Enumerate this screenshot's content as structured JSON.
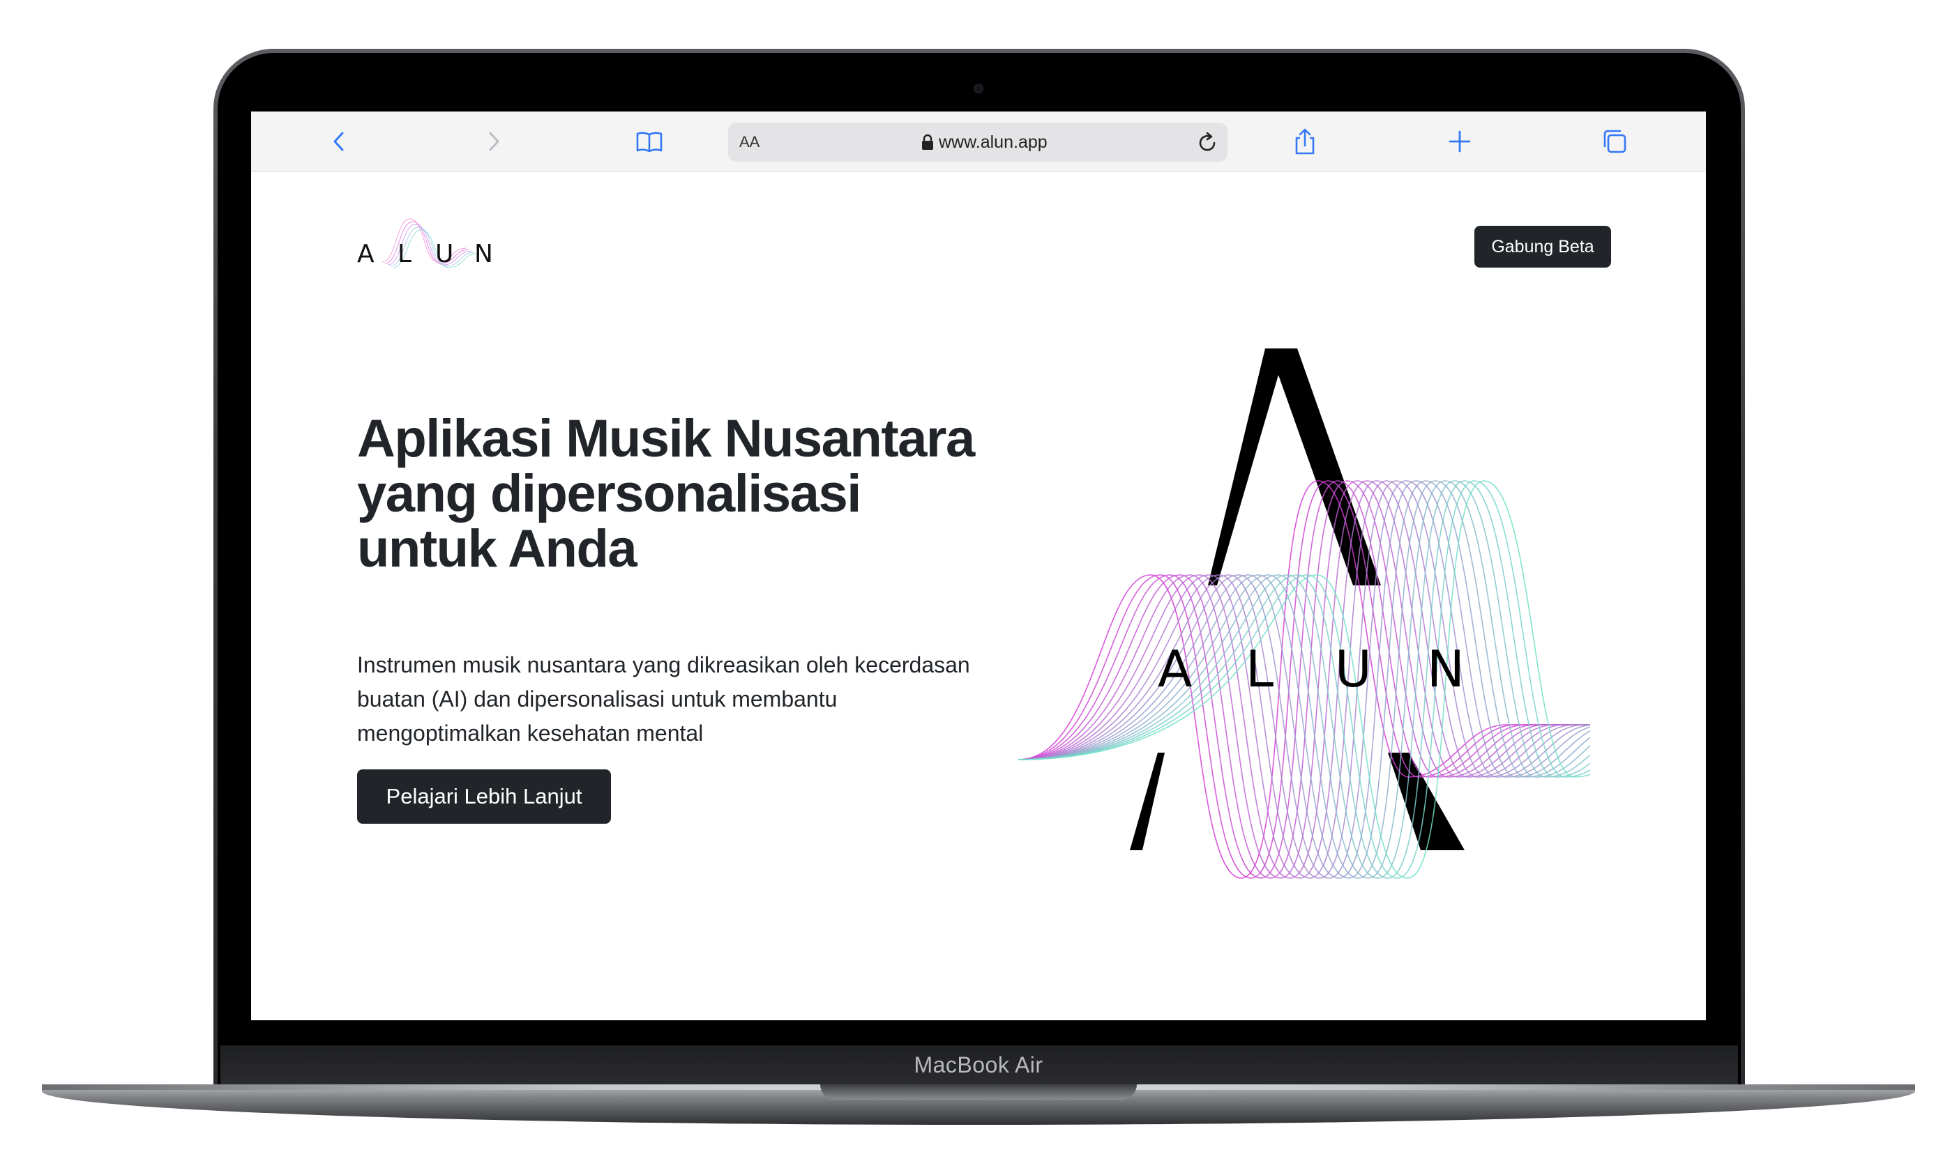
{
  "device": {
    "label": "MacBook Air"
  },
  "browser": {
    "text_size_label": "AA",
    "url": "www.alun.app",
    "icons": [
      "back-icon",
      "forward-icon",
      "bookmarks-icon",
      "lock-icon",
      "reload-icon",
      "share-icon",
      "new-tab-icon",
      "tabs-icon"
    ]
  },
  "page": {
    "logo_letters": [
      "A",
      "L",
      "U",
      "N"
    ],
    "join_beta_label": "Gabung Beta",
    "hero_title": "Aplikasi Musik Nusantara yang dipersonalisasi untuk Anda",
    "hero_description": "Instrumen musik nusantara yang dikreasikan oleh kecerdasan buatan (AI) dan dipersonalisasi untuk membantu mengoptimalkan kesehatan mental",
    "cta_label": "Pelajari Lebih Lanjut",
    "art_letters": [
      "A",
      "L",
      "U",
      "N"
    ]
  },
  "colors": {
    "dark": "#212529",
    "accent_magenta": "#d63ad6",
    "accent_teal": "#6fe0c8",
    "safari_blue": "#3478f6"
  }
}
